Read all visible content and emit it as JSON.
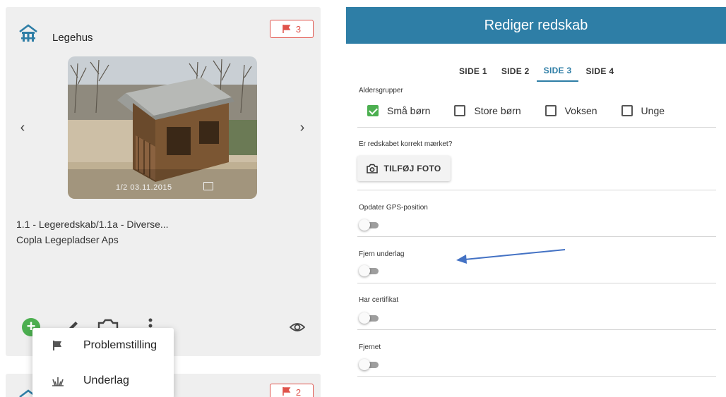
{
  "left_card": {
    "title": "Legehus",
    "flag_count": "3",
    "photo_caption": "1/2   03.11.2015",
    "line1": "1.1 - Legeredskab/1.1a - Diverse...",
    "line2": "Copla Legepladser Aps",
    "prev_arrow": "‹",
    "next_arrow": "›",
    "add_label": "+"
  },
  "second_card": {
    "flag_count": "2"
  },
  "context_menu": {
    "items": [
      {
        "label": "Problemstilling",
        "icon": "flag-icon"
      },
      {
        "label": "Underlag",
        "icon": "grass-icon"
      }
    ]
  },
  "editor": {
    "title": "Rediger redskab",
    "tabs": [
      {
        "label": "SIDE 1",
        "active": false
      },
      {
        "label": "SIDE 2",
        "active": false
      },
      {
        "label": "SIDE 3",
        "active": true
      },
      {
        "label": "SIDE 4",
        "active": false
      }
    ],
    "age_groups": {
      "label": "Aldersgrupper",
      "options": [
        {
          "label": "Små børn",
          "checked": true
        },
        {
          "label": "Store børn",
          "checked": false
        },
        {
          "label": "Voksen",
          "checked": false
        },
        {
          "label": "Unge",
          "checked": false
        }
      ]
    },
    "marked": {
      "label": "Er redskabet korrekt mærket?",
      "button_label": "TILFØJ FOTO"
    },
    "toggles": [
      {
        "label": "Opdater GPS-position",
        "on": false
      },
      {
        "label": "Fjern underlag",
        "on": false
      },
      {
        "label": "Har certifikat",
        "on": false
      },
      {
        "label": "Fjernet",
        "on": false
      }
    ]
  },
  "colors": {
    "header": "#2e7ea6",
    "accent": "#2e7ea6",
    "flag": "#e0534b",
    "check": "#4caf50",
    "annotation_arrow": "#4472c4"
  }
}
